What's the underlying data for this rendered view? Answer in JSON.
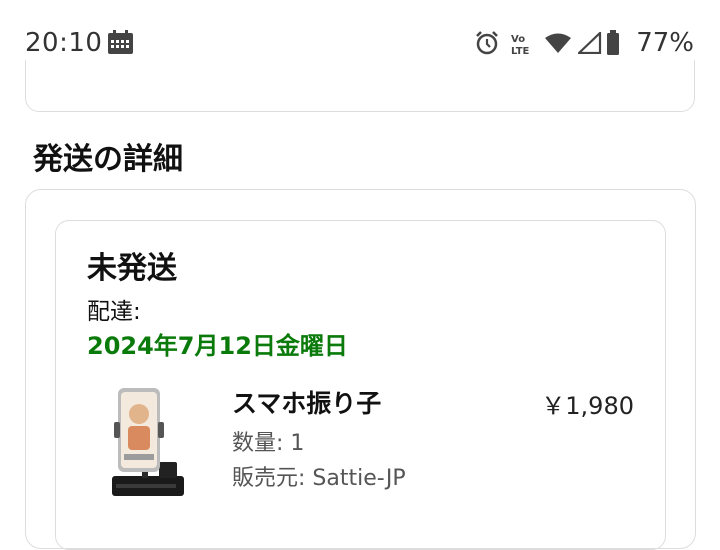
{
  "status_bar": {
    "time": "20:10",
    "battery": "77%",
    "icons": [
      "calendar-icon",
      "alarm-icon",
      "volte-icon",
      "wifi-icon",
      "cell-signal-icon",
      "battery-icon"
    ]
  },
  "shipment": {
    "section_title": "発送の詳細",
    "status": "未発送",
    "delivery_label": "配達:",
    "delivery_date": "2024年7月12日金曜日",
    "colors": {
      "delivery_date": "#0a7a0a"
    },
    "items": [
      {
        "name": "スマホ振り子",
        "price": "￥1,980",
        "quantity": "数量: 1",
        "seller": "販売元: Sattie-JP",
        "image": "phone-stand-product-image"
      }
    ]
  }
}
